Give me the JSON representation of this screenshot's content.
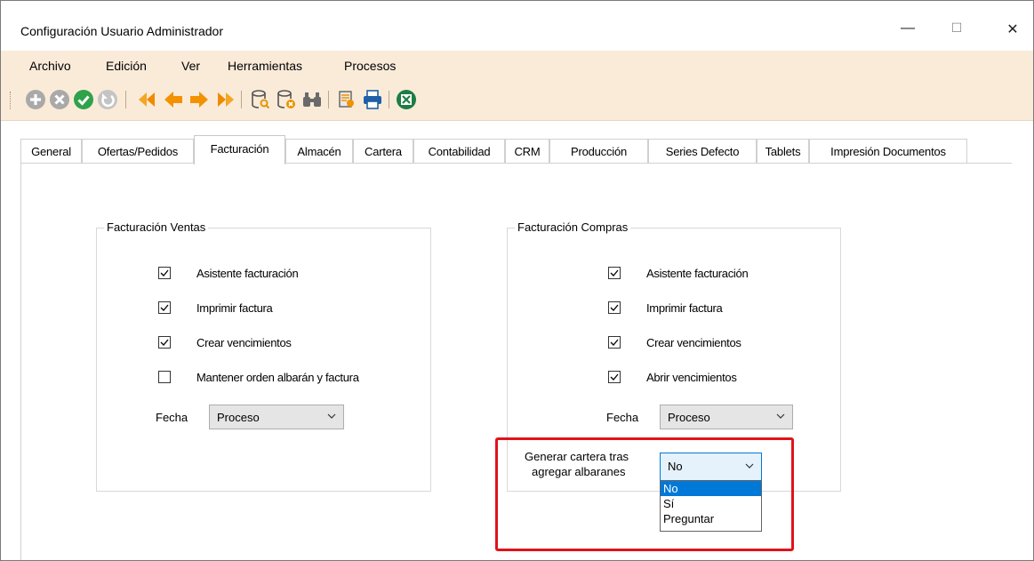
{
  "window": {
    "title": "Configuración Usuario Administrador",
    "minimize": "—",
    "maximize": "☐",
    "close": "✕"
  },
  "menu": [
    "Archivo",
    "Edición",
    "Ver",
    "Herramientas",
    "Procesos"
  ],
  "toolbar": {
    "icons": [
      "add-icon",
      "delete-icon",
      "confirm-icon",
      "undo-icon",
      "first-record-icon",
      "previous-record-icon",
      "next-record-icon",
      "last-record-icon",
      "search-database-icon",
      "delete-database-icon",
      "find-binoculars-icon",
      "preview-document-icon",
      "print-icon",
      "excel-export-icon"
    ]
  },
  "tabs": [
    "General",
    "Ofertas/Pedidos",
    "Facturación",
    "Almacén",
    "Cartera",
    "Contabilidad",
    "CRM",
    "Producción",
    "Series Defecto",
    "Tablets",
    "Impresión Documentos"
  ],
  "active_tab": "Facturación",
  "ventas": {
    "legend": "Facturación Ventas",
    "options": [
      {
        "label": "Asistente facturación",
        "checked": true
      },
      {
        "label": "Imprimir factura",
        "checked": true
      },
      {
        "label": "Crear vencimientos",
        "checked": true
      },
      {
        "label": "Mantener orden albarán y factura",
        "checked": false
      }
    ],
    "fecha_label": "Fecha",
    "fecha_value": "Proceso"
  },
  "compras": {
    "legend": "Facturación Compras",
    "options": [
      {
        "label": "Asistente facturación",
        "checked": true
      },
      {
        "label": "Imprimir factura",
        "checked": true
      },
      {
        "label": "Crear vencimientos",
        "checked": true
      },
      {
        "label": "Abrir vencimientos",
        "checked": true
      }
    ],
    "fecha_label": "Fecha",
    "fecha_value": "Proceso",
    "cartera_label_line1": "Generar cartera tras",
    "cartera_label_line2": "agregar albaranes",
    "cartera_value": "No",
    "cartera_options": [
      "No",
      "Sí",
      "Preguntar"
    ],
    "cartera_selected_index": 0
  },
  "colors": {
    "menubar_bg": "#faebd9",
    "highlight": "#e0131a",
    "selection": "#0078d7"
  }
}
